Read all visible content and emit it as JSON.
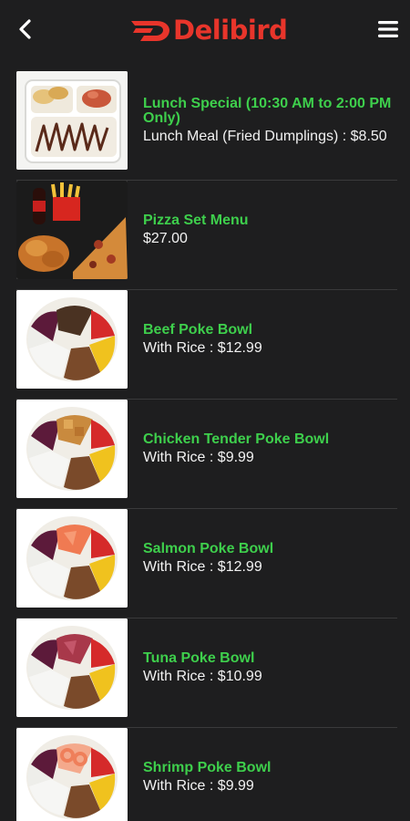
{
  "colors": {
    "background": "#1e1e1f",
    "brand": "#e8352b",
    "item_name": "#3ecf4c",
    "text": "#f2f2f2",
    "separator": "#3a3a3b"
  },
  "header": {
    "app_name": "Delibird",
    "back_icon": "chevron-left-icon",
    "menu_icon": "hamburger-menu-icon"
  },
  "items": [
    {
      "name": "Lunch Special (10:30 AM to 2:00 PM Only)",
      "desc": "Lunch Meal (Fried Dumplings) : $8.50"
    },
    {
      "name": "Pizza Set Menu",
      "desc": "$27.00"
    },
    {
      "name": "Beef Poke Bowl",
      "desc": "With Rice : $12.99"
    },
    {
      "name": "Chicken Tender Poke Bowl",
      "desc": "With Rice : $9.99"
    },
    {
      "name": "Salmon Poke Bowl",
      "desc": "With Rice : $12.99"
    },
    {
      "name": "Tuna Poke Bowl",
      "desc": "With Rice : $10.99"
    },
    {
      "name": "Shrimp Poke Bowl",
      "desc": "With Rice : $9.99"
    }
  ]
}
